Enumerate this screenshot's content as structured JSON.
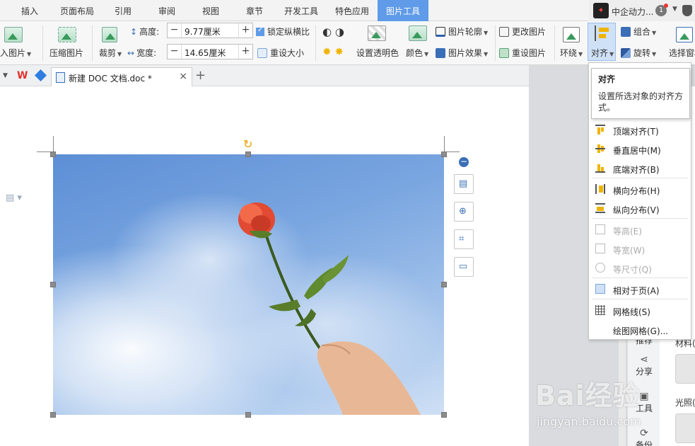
{
  "tabs": [
    "插入",
    "页面布局",
    "引用",
    "审阅",
    "视图",
    "章节",
    "开发工具",
    "特色应用",
    "图片工具"
  ],
  "active_tab_index": 8,
  "user": {
    "name": "中企动力...",
    "badge": "1"
  },
  "ribbon": {
    "insert_image": "入图片",
    "compress_image": "压缩图片",
    "crop": "裁剪",
    "height_label": "高度:",
    "height_value": "9.77厘米",
    "width_label": "宽度:",
    "width_value": "14.65厘米",
    "lock_ratio": "锁定纵横比",
    "reset_size": "重设大小",
    "set_transparent": "设置透明色",
    "color": "颜色",
    "image_outline": "图片轮廓",
    "image_effect": "图片效果",
    "change_image": "更改图片",
    "reset_image": "重设图片",
    "wrap": "环绕",
    "align": "对齐",
    "group": "组合",
    "rotate": "旋转",
    "select_pane": "选择窗格"
  },
  "doc_tab": {
    "title": "新建 DOC 文档.doc *",
    "close": "×",
    "new_tab": "+"
  },
  "tooltip": {
    "title": "对齐",
    "desc": "设置所选对象的对齐方式。"
  },
  "menu": {
    "items": [
      {
        "label": "顶端对齐(T)",
        "icon": "align-top-icon",
        "disabled": false
      },
      {
        "label": "垂直居中(M)",
        "icon": "align-middle-icon",
        "disabled": false
      },
      {
        "label": "底端对齐(B)",
        "icon": "align-bottom-icon",
        "disabled": false
      },
      {
        "label": "横向分布(H)",
        "icon": "distribute-horizontal-icon",
        "disabled": false
      },
      {
        "label": "纵向分布(V)",
        "icon": "distribute-vertical-icon",
        "disabled": false
      },
      {
        "label": "等高(E)",
        "icon": "equal-height-icon",
        "disabled": true
      },
      {
        "label": "等宽(W)",
        "icon": "equal-width-icon",
        "disabled": true
      },
      {
        "label": "等尺寸(Q)",
        "icon": "equal-size-icon",
        "disabled": true
      },
      {
        "label": "相对于页(A)",
        "icon": "relative-to-page-icon",
        "disabled": false,
        "checked": true
      },
      {
        "label": "网格线(S)",
        "icon": "gridlines-icon",
        "disabled": false
      },
      {
        "label": "绘图网格(G)...",
        "icon": "drawing-grid-icon",
        "disabled": false
      }
    ]
  },
  "right_panel": {
    "share": "分享",
    "tools": "工具",
    "backup": "备份",
    "material": "材料(",
    "lighting": "光照(",
    "push": "推荐"
  },
  "watermark": {
    "logo": "Bai经验",
    "url": "jingyan.baidu.com"
  },
  "colors": {
    "active_tab": "#5f9be8",
    "accent": "#3a6fb7",
    "handle_orange": "#e8a000"
  }
}
